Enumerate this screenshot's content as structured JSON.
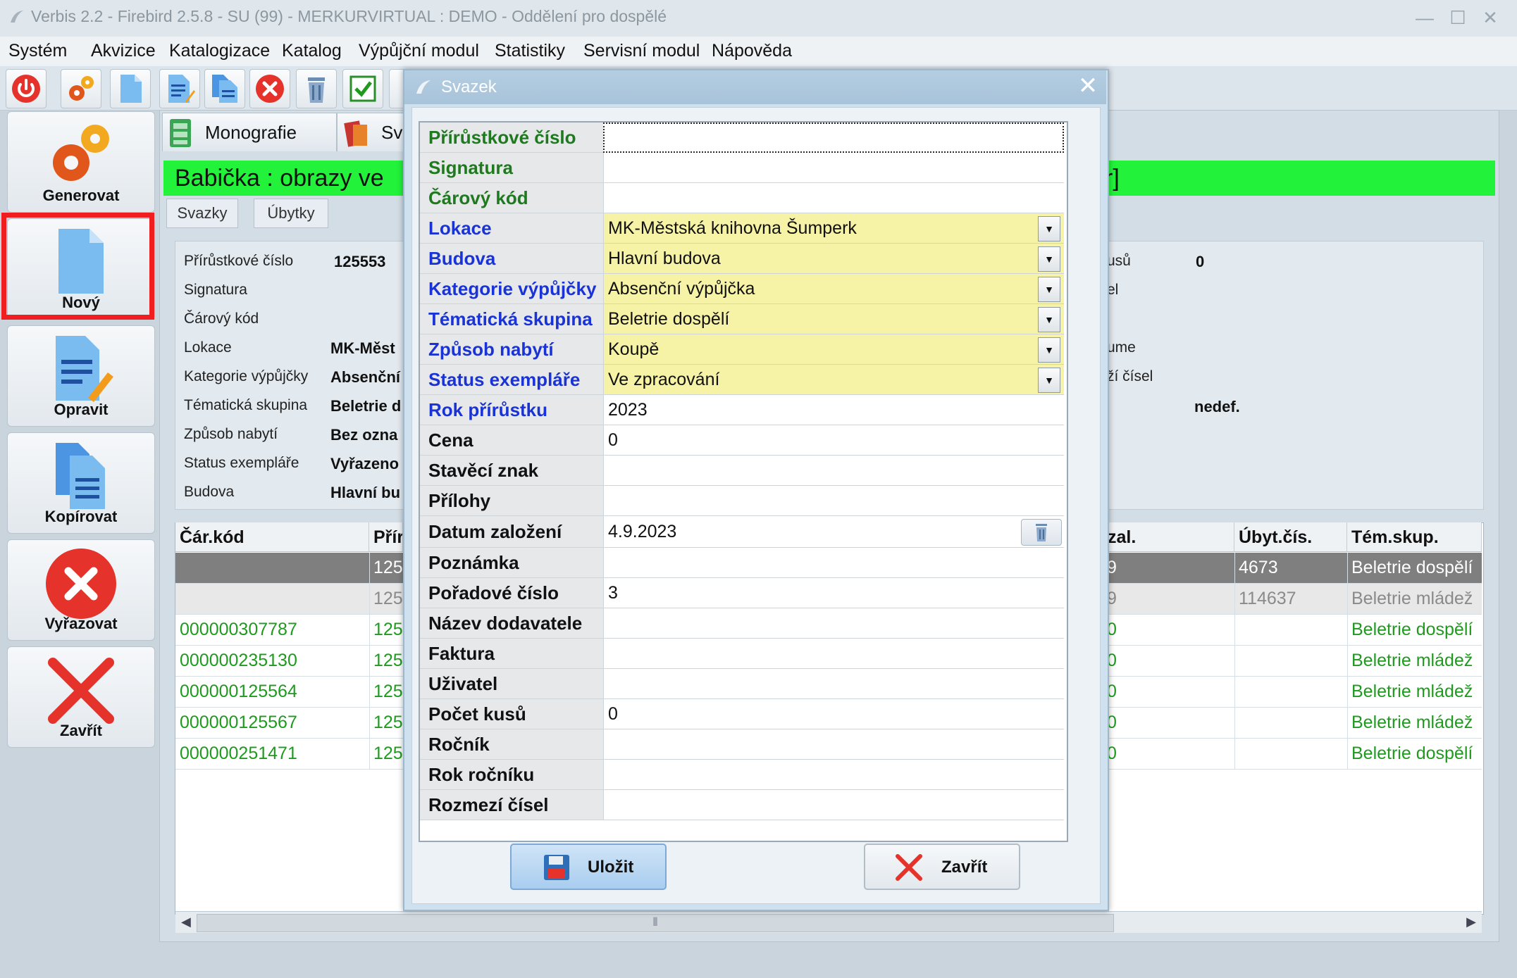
{
  "window": {
    "title": "Verbis 2.2 - Firebird 2.5.8 - SU (99) - MERKURVIRTUAL : DEMO - Oddělení pro dospělé"
  },
  "menu": [
    "Systém",
    "Akvizice",
    "Katalogizace",
    "Katalog",
    "Výpůjční modul",
    "Statistiky",
    "Servisní modul",
    "Nápověda"
  ],
  "toolbar_icons": [
    "power-icon",
    "gears-icon",
    "new-document-icon",
    "edit-document-icon",
    "copy-documents-icon",
    "delete-icon",
    "trash-icon",
    "checkmark-icon"
  ],
  "sidebar": {
    "generate": "Generovat",
    "new": "Nový",
    "edit": "Opravit",
    "copy": "Kopírovat",
    "discard": "Vyřazovat",
    "close": "Zavřít"
  },
  "tabs": {
    "monographs": "Monografie",
    "second": "Sv"
  },
  "record_title": {
    "left": "Babička : obrazy ve",
    "right": "r]"
  },
  "subtabs": [
    "Svazky",
    "Úbytky"
  ],
  "detail": {
    "labels": [
      "Přírůstkové číslo",
      "Signatura",
      "Čárový kód",
      "Lokace",
      "Kategorie výpůjčky",
      "Tématická skupina",
      "Způsob nabytí",
      "Status exempláře",
      "Budova"
    ],
    "values": [
      "125553",
      "",
      "",
      "MK-Měst",
      "Absenční",
      "Beletrie d",
      "Bez ozna",
      "Vyřazeno",
      "Hlavní bu"
    ],
    "right_labels": [
      "usů",
      "el",
      "ume",
      "ží čísel"
    ],
    "right_count": "0",
    "right_nedef": "nedef."
  },
  "table": {
    "headers": [
      "Čár.kód",
      "Přír",
      "zal.",
      "Úbyt.čís.",
      "Tém.skup."
    ],
    "rows": [
      {
        "barcode": "",
        "acc": "125",
        "zal": "9",
        "ubyt": "4673",
        "group": "Beletrie dospělí"
      },
      {
        "barcode": "",
        "acc": "125",
        "zal": "9",
        "ubyt": "114637",
        "group": "Beletrie mládež"
      },
      {
        "barcode": "000000307787",
        "acc": "125",
        "zal": "0",
        "ubyt": "",
        "group": "Beletrie dospělí"
      },
      {
        "barcode": "000000235130",
        "acc": "125",
        "zal": "0",
        "ubyt": "",
        "group": "Beletrie mládež"
      },
      {
        "barcode": "000000125564",
        "acc": "125",
        "zal": "0",
        "ubyt": "",
        "group": "Beletrie mládež"
      },
      {
        "barcode": "000000125567",
        "acc": "125",
        "zal": "0",
        "ubyt": "",
        "group": "Beletrie mládež"
      },
      {
        "barcode": "000000251471",
        "acc": "125",
        "zal": "0",
        "ubyt": "",
        "group": "Beletrie dospělí"
      }
    ],
    "scroll_grip": "⦀"
  },
  "dialog": {
    "title": "Svazek",
    "fields": [
      {
        "label": "Přírůstkové číslo",
        "value": "",
        "type": "input",
        "color": "#1f7a1f"
      },
      {
        "label": "Signatura",
        "value": "",
        "type": "text",
        "color": "#1f7a1f"
      },
      {
        "label": "Čárový kód",
        "value": "",
        "type": "text",
        "color": "#1f7a1f"
      },
      {
        "label": "Lokace",
        "value": "MK-Městská knihovna Šumperk",
        "type": "select",
        "color": "#1a33d6"
      },
      {
        "label": "Budova",
        "value": "Hlavní budova",
        "type": "select",
        "color": "#1a33d6"
      },
      {
        "label": "Kategorie výpůjčky",
        "value": "Absenční výpůjčka",
        "type": "select",
        "color": "#1a33d6"
      },
      {
        "label": "Tématická skupina",
        "value": "Beletrie dospělí",
        "type": "select",
        "color": "#1a33d6"
      },
      {
        "label": "Způsob nabytí",
        "value": "Koupě",
        "type": "select",
        "color": "#1a33d6"
      },
      {
        "label": "Status exempláře",
        "value": "Ve zpracování",
        "type": "select",
        "color": "#1a33d6"
      },
      {
        "label": "Rok přírůstku",
        "value": "2023",
        "type": "text",
        "color": "#1a33d6"
      },
      {
        "label": "Cena",
        "value": "0",
        "type": "text",
        "color": "#111111"
      },
      {
        "label": "Stavěcí znak",
        "value": "",
        "type": "text",
        "color": "#111111"
      },
      {
        "label": "Přílohy",
        "value": "",
        "type": "text",
        "color": "#111111"
      },
      {
        "label": "Datum založení",
        "value": "4.9.2023",
        "type": "date",
        "color": "#111111"
      },
      {
        "label": "Poznámka",
        "value": "",
        "type": "text",
        "color": "#111111"
      },
      {
        "label": "Pořadové číslo",
        "value": "3",
        "type": "text",
        "color": "#111111"
      },
      {
        "label": "Název dodavatele",
        "value": "",
        "type": "text",
        "color": "#111111"
      },
      {
        "label": "Faktura",
        "value": "",
        "type": "text",
        "color": "#111111"
      },
      {
        "label": "Uživatel",
        "value": "",
        "type": "text",
        "color": "#111111"
      },
      {
        "label": "Počet kusů",
        "value": "0",
        "type": "text",
        "color": "#111111"
      },
      {
        "label": "Ročník",
        "value": "",
        "type": "text",
        "color": "#111111"
      },
      {
        "label": "Rok ročníku",
        "value": "",
        "type": "text",
        "color": "#111111"
      },
      {
        "label": "Rozmezí čísel",
        "value": "",
        "type": "text",
        "color": "#111111"
      }
    ],
    "save": "Uložit",
    "close": "Zavřít"
  },
  "colors": {
    "green_text": "#1f9a1f",
    "highlight": "#f01e1e",
    "title_bar_green": "#22f23a",
    "select_bg": "#f6f2a6"
  }
}
